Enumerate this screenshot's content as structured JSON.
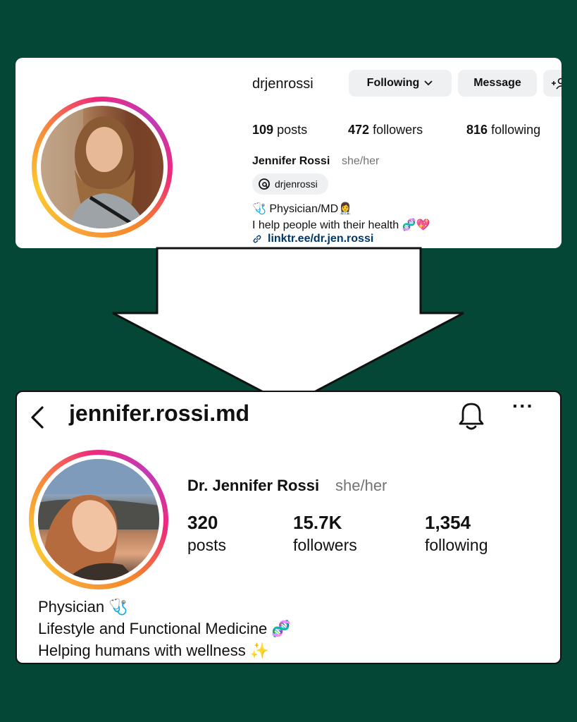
{
  "old_profile": {
    "username": "drjenrossi",
    "following_button": "Following",
    "message_button": "Message",
    "add_user_glyph": "+♀",
    "stats": {
      "posts_count": "109",
      "posts_label": "posts",
      "followers_count": "472",
      "followers_label": "followers",
      "following_count": "816",
      "following_label": "following"
    },
    "display_name": "Jennifer Rossi",
    "pronouns": "she/her",
    "threads_handle": "drjenrossi",
    "bio_line1": "🩺 Physician/MD👩‍⚕️",
    "bio_line2": "I help people with their health 🧬💖",
    "link": "linktr.ee/dr.jen.rossi"
  },
  "new_profile": {
    "username": "jennifer.rossi.md",
    "more_glyph": "···",
    "display_name": "Dr. Jennifer Rossi",
    "pronouns": "she/her",
    "stats": {
      "posts_count": "320",
      "posts_label": "posts",
      "followers_count": "15.7K",
      "followers_label": "followers",
      "following_count": "1,354",
      "following_label": "following"
    },
    "bio_line1": "Physician 🩺",
    "bio_line2": "Lifestyle and Functional Medicine 🧬",
    "bio_line3": "Helping humans with wellness ✨"
  },
  "colors": {
    "background": "#054736",
    "link": "#00376b",
    "muted": "#737373",
    "button_bg": "#eff0f2"
  }
}
